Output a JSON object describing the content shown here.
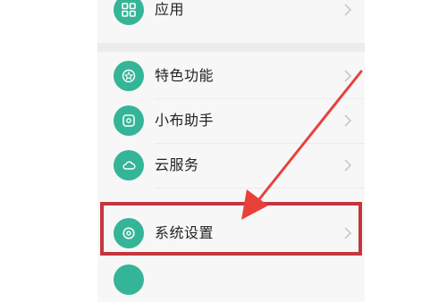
{
  "settings_list": {
    "items": [
      {
        "label": "应用",
        "icon": "apps-grid-icon"
      },
      {
        "label": "特色功能",
        "icon": "star-icon"
      },
      {
        "label": "小布助手",
        "icon": "assistant-icon"
      },
      {
        "label": "云服务",
        "icon": "cloud-icon"
      },
      {
        "label": "系统设置",
        "icon": "gear-icon"
      }
    ]
  },
  "annotation": {
    "highlight_color": "#c4363d",
    "arrow_color": "#e8413a",
    "highlighted_item": "系统设置"
  },
  "colors": {
    "icon_background": "#35b597",
    "screen_background": "#f7f7f7"
  }
}
